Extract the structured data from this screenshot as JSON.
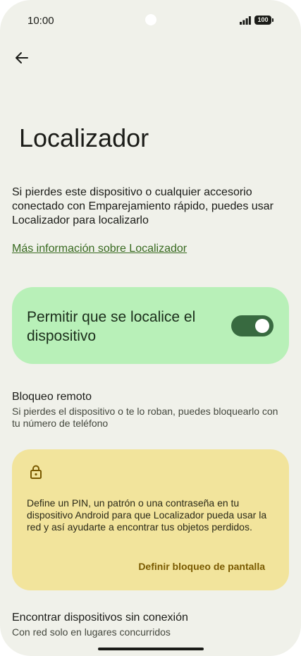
{
  "status_bar": {
    "time": "10:00",
    "battery": "100",
    "icons": [
      "signal-icon",
      "battery-icon"
    ]
  },
  "header": {
    "back_icon": "back-arrow-icon",
    "title": "Localizador"
  },
  "description": "Si pierdes este dispositivo o cualquier accesorio conectado con Emparejamiento rápido, puedes usar Localizador para localizarlo",
  "learn_more_link": "Más información sobre Localizador",
  "main_toggle": {
    "label": "Permitir que se localice el dispositivo",
    "checked": true,
    "card_color": "#b8f0b8",
    "switch_color": "#386a40"
  },
  "remote_lock": {
    "title": "Bloqueo remoto",
    "summary": "Si pierdes el dispositivo o te lo roban, puedes bloquearlo con tu número de teléfono"
  },
  "warning_card": {
    "icon": "lock-icon",
    "text": "Define un PIN, un patrón o una contraseña en tu dispositivo Android para que Localizador pueda usar la red y así ayudarte a encontrar tus objetos perdidos.",
    "action": "Definir bloqueo de pantalla",
    "card_color": "#f2e49c",
    "action_color": "#7a5a00"
  },
  "offline_devices": {
    "title": "Encontrar dispositivos sin conexión",
    "summary": "Con red solo en lugares concurridos"
  },
  "colors": {
    "background": "#f0f1ea",
    "link": "#386a20"
  }
}
